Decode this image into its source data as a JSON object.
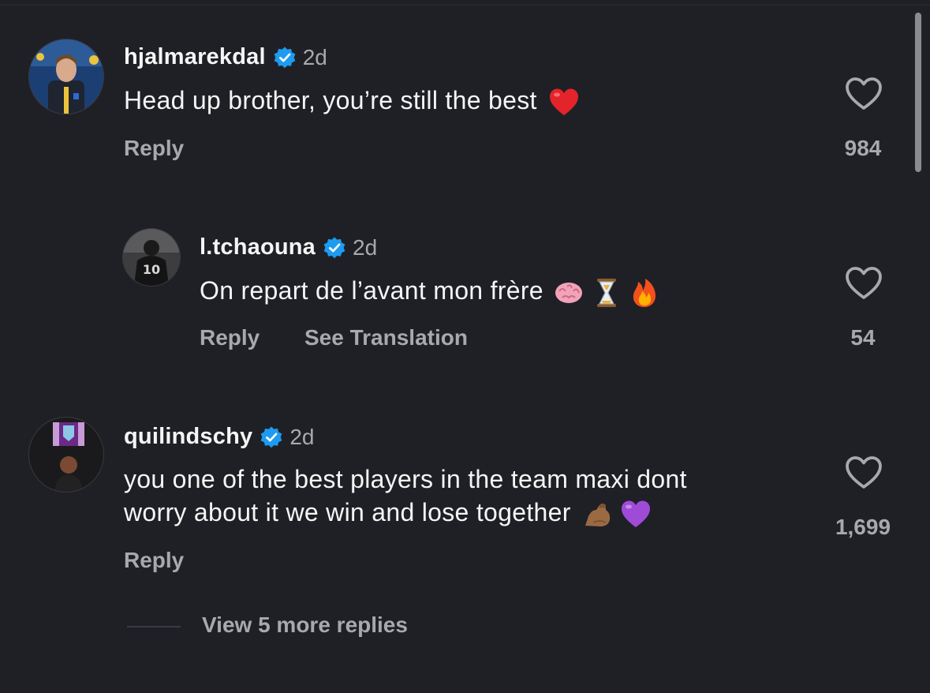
{
  "comments": [
    {
      "username": "hjalmarekdal",
      "time": "2d",
      "text": "Head up brother, you’re still the best",
      "emoji": [
        "red-heart"
      ],
      "reply_label": "Reply",
      "likes": "984"
    },
    {
      "username": "l.tchaouna",
      "time": "2d",
      "text": "On repart de l’avant mon frère",
      "emoji": [
        "brain",
        "hourglass",
        "fire"
      ],
      "reply_label": "Reply",
      "translate_label": "See Translation",
      "likes": "54",
      "avatar_jersey": "10"
    },
    {
      "username": "quilindschy",
      "time": "2d",
      "text_line1": "you one of the best players in the team maxi dont",
      "text_line2": "worry about it we win and lose together",
      "emoji": [
        "flexed-biceps",
        "purple-heart"
      ],
      "reply_label": "Reply",
      "likes": "1,699"
    }
  ],
  "view_more_label": "View 5 more replies",
  "colors": {
    "background": "#1f2026",
    "text_primary": "#f5f5f5",
    "text_secondary": "#a8a9ae",
    "verified_blue": "#1d9bf0"
  }
}
